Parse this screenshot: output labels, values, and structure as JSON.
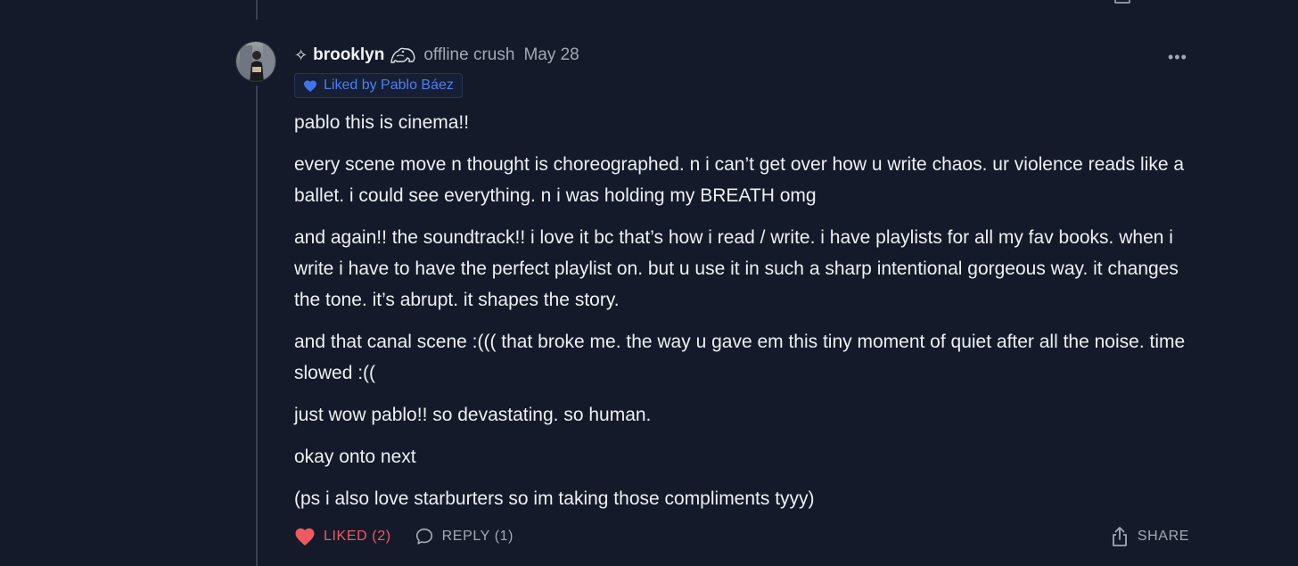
{
  "comment": {
    "author": "brooklyn",
    "author_note": "offline crush",
    "date": "May 28",
    "liked_by": "Liked by Pablo Báez",
    "paragraphs": [
      "pablo this is cinema!!",
      "every scene move n thought is choreographed. n i can’t get over how u write chaos. ur violence reads like a ballet. i could see everything. n i was holding my BREATH omg",
      "and again!! the soundtrack!! i love it bc that’s how i read / write. i have playlists for all my fav books. when i write i have to have the perfect playlist on. but u use it in such a sharp intentional gorgeous way. it changes the tone. it’s abrupt. it shapes the story.",
      "and that canal scene :((( that broke me. the way u gave em this tiny moment of quiet after all the noise. time slowed :((",
      "just wow pablo!! so devastating. so human.",
      "okay onto next",
      "(ps i also love starburters so im taking those compliments tyyy)"
    ]
  },
  "actions": {
    "like_label": "LIKED (2)",
    "reply_label": "REPLY (1)",
    "share_label": "SHARE"
  },
  "icons": {
    "sparkle": "✧",
    "more": "•••"
  },
  "colors": {
    "background": "#141a29",
    "liked": "#ef5a60",
    "liked_by": "#4f7ef0",
    "muted": "#a3a8b5"
  }
}
